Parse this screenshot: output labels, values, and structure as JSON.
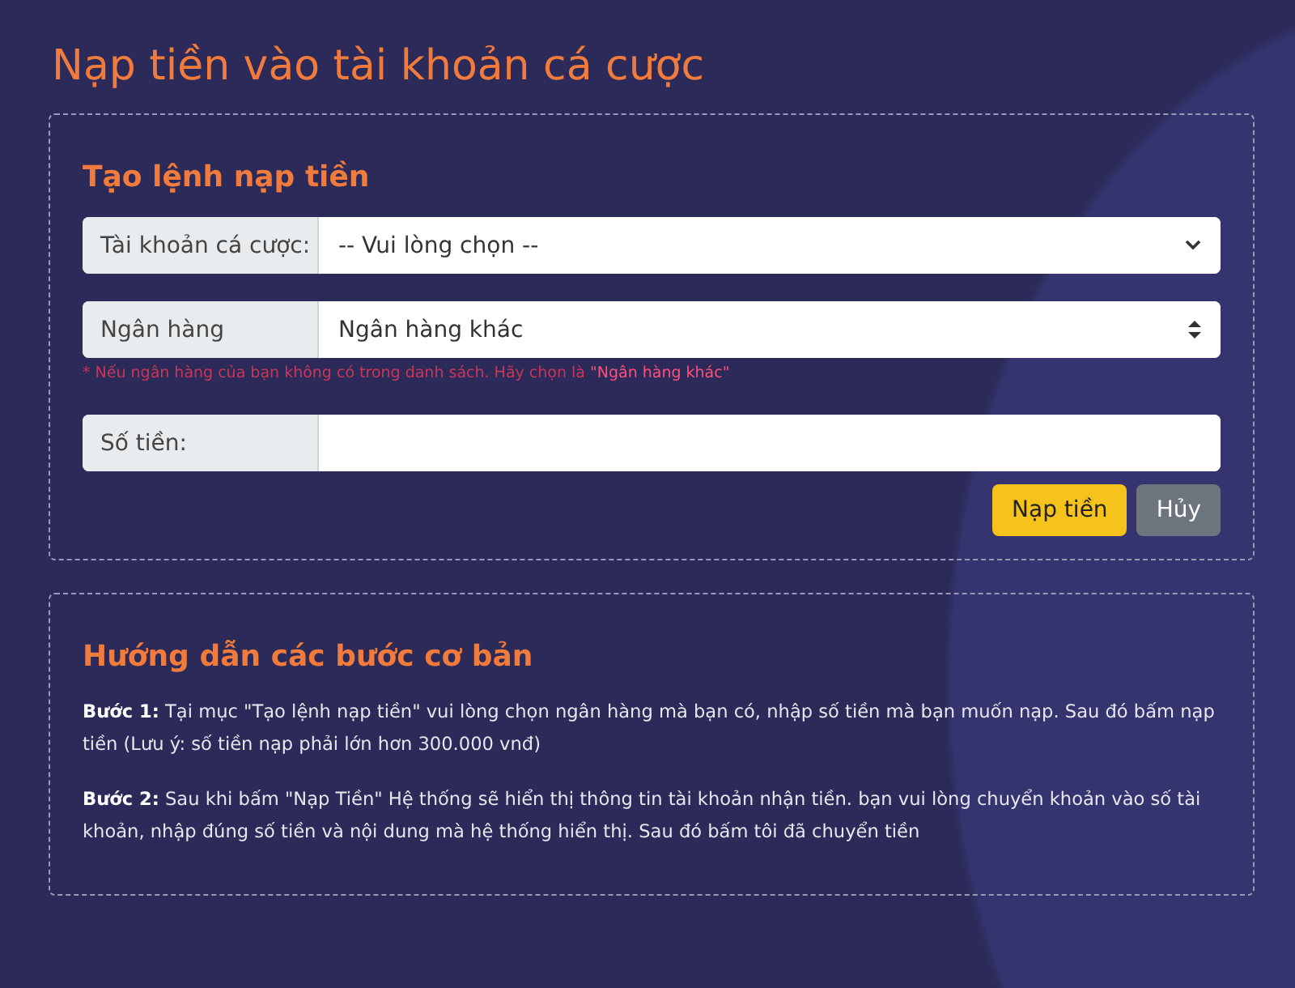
{
  "page_title": "Nạp tiền vào tài khoản cá cược",
  "deposit_form": {
    "title": "Tạo lệnh nạp tiền",
    "fields": [
      {
        "kind": "select",
        "label": "Tài khoản cá cược:",
        "value": "-- Vui lòng chọn --"
      },
      {
        "kind": "sorted-select",
        "label": "Ngân hàng",
        "value": "Ngân hàng khác",
        "hint": {
          "text": "* Nếu ngân hàng của bạn không có trong danh sách. Hãy chọn là ",
          "highlight": "\"Ngân hàng khác\""
        }
      },
      {
        "kind": "input",
        "label": "Số tiền:"
      }
    ],
    "buttons": [
      {
        "kind": "primary",
        "label": "Nạp tiền"
      },
      {
        "kind": "secondary",
        "label": "Hủy"
      }
    ]
  },
  "guide": {
    "title": "Hướng dẫn các bước cơ bản",
    "steps": [
      "**Bước 1:** Tại mục \"Tạo lệnh nạp tiền\" vui lòng chọn ngân hàng mà bạn có, nhập số tiền mà bạn muốn nạp. Sau đó bấm nạp tiền (Lưu ý: số tiền nạp phải lớn hơn 300.000 vnđ)",
      "**Bước 2:** Sau khi bấm \"Nạp Tiền\" Hệ thống sẽ hiển thị thông tin tài khoản nhận tiền. bạn vui lòng chuyển khoản vào số tài khoản, nhập đúng số tiền và nội dung mà hệ thống hiển thị. Sau đó bấm tôi đã chuyển tiền"
    ]
  }
}
